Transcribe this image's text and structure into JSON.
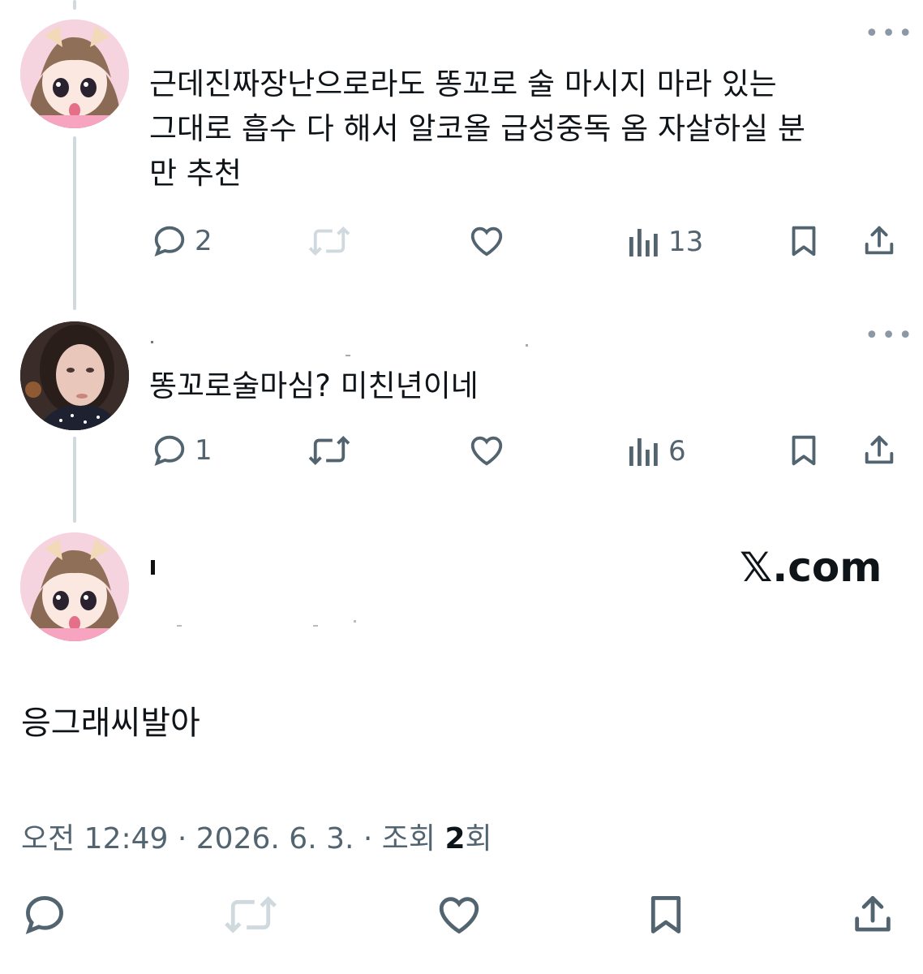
{
  "reply1": {
    "text_lines": [
      "근데진짜장난으로라도 똥꼬로 술 마시지 마라 있는",
      "그대로 흡수 다 해서 알코올 급성중독 옴 자살하실 분",
      "만 추천"
    ],
    "more_icon": "more-horizontal-icon",
    "actions": {
      "replies": "2",
      "retweets": "",
      "likes": "",
      "views": "13"
    },
    "retweet_disabled": true
  },
  "reply2": {
    "text": "똥꼬로술마심? 미친년이네",
    "more_icon": "more-horizontal-icon",
    "actions": {
      "replies": "1",
      "retweets": "",
      "likes": "",
      "views": "6"
    }
  },
  "main_tweet": {
    "text": "응그래씨발아",
    "watermark": "𝕏.com",
    "meta": {
      "time": "오전 12:49",
      "sep1": " · ",
      "date": "2026. 6. 3.",
      "sep2": " · ",
      "views_prefix": "조회 ",
      "views_count": "2",
      "views_suffix": "회"
    }
  },
  "colors": {
    "text": "#0f1419",
    "icon": "#536471",
    "muted": "#8b98a5",
    "thread_line": "#cfd9de",
    "disabled": "#cfd9de"
  }
}
